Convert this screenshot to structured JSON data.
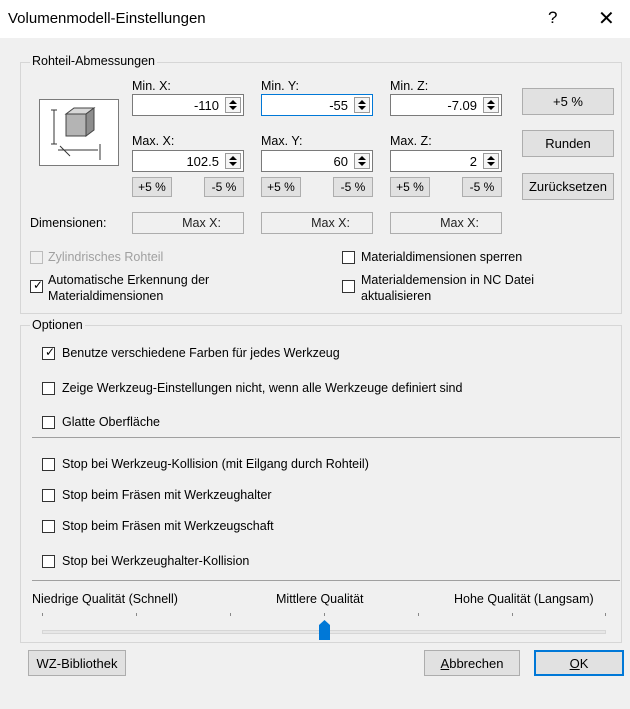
{
  "window": {
    "title": "Volumenmodell-Einstellungen",
    "help": "?",
    "close": "✕"
  },
  "stock": {
    "group_label": "Rohteil-Abmessungen",
    "min_x": {
      "label": "Min. X:",
      "value": "-110"
    },
    "min_y": {
      "label": "Min. Y:",
      "value": "-55"
    },
    "min_z": {
      "label": "Min. Z:",
      "value": "-7.09"
    },
    "max_x": {
      "label": "Max. X:",
      "value": "102.5"
    },
    "max_y": {
      "label": "Max. Y:",
      "value": "60"
    },
    "max_z": {
      "label": "Max. Z:",
      "value": "2"
    },
    "plus_label": "+5 %",
    "minus_label": "-5 %",
    "btn_plus5": "+5 %",
    "btn_round": "Runden",
    "btn_reset": "Zurücksetzen",
    "dimensions_label": "Dimensionen:",
    "dim_values": [
      "Max X:",
      "Max X:",
      "Max X:"
    ],
    "cylindrical": "Zylindrisches Rohteil",
    "auto_detect": "Automatische Erkennung der Materialdimensionen",
    "lock_dims": "Materialdimensionen sperren",
    "update_nc": "Materialdemension in NC Datei aktualisieren"
  },
  "options": {
    "group_label": "Optionen",
    "items": [
      "Benutze verschiedene Farben für jedes Werkzeug",
      "Zeige Werkzeug-Einstellungen nicht, wenn alle Werkzeuge definiert sind",
      "Glatte Oberfläche",
      "Stop bei Werkzeug-Kollision (mit Eilgang durch Rohteil)",
      "Stop beim Fräsen mit Werkzeughalter",
      "Stop beim Fräsen mit Werkzeugschaft",
      "Stop bei Werkzeughalter-Kollision"
    ],
    "quality_low": "Niedrige Qualität (Schnell)",
    "quality_mid": "Mittlere Qualität",
    "quality_high": "Hohe Qualität (Langsam)",
    "quality_level": 0.5
  },
  "footer": {
    "library": "WZ-Bibliothek",
    "cancel": "Abbrechen",
    "ok": "OK"
  },
  "colors": {
    "accent": "#0078d7",
    "slider_thumb": "#0078d7"
  }
}
